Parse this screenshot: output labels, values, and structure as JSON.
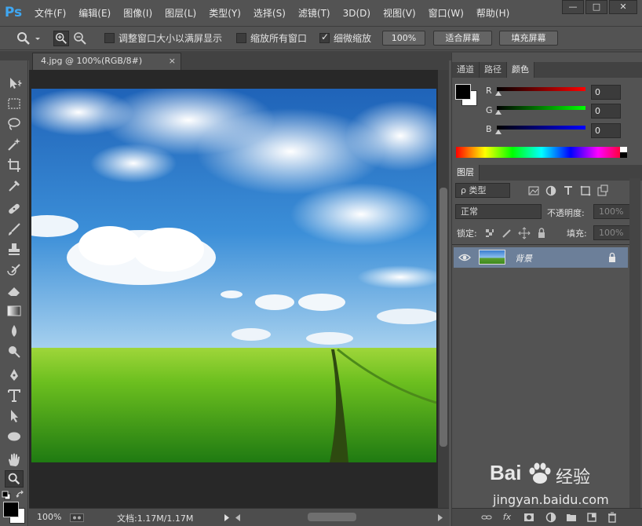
{
  "app": {
    "logo": "Ps",
    "menus": [
      "文件(F)",
      "编辑(E)",
      "图像(I)",
      "图层(L)",
      "类型(Y)",
      "选择(S)",
      "滤镜(T)",
      "3D(D)",
      "视图(V)",
      "窗口(W)",
      "帮助(H)"
    ],
    "window_controls": [
      "—",
      "□",
      "✕"
    ]
  },
  "options": {
    "resize_windows_label": "调整窗口大小以满屏显示",
    "resize_windows_checked": false,
    "zoom_all_label": "缩放所有窗口",
    "zoom_all_checked": false,
    "scrubby_label": "细微缩放",
    "scrubby_checked": true,
    "btn_100": "100%",
    "btn_fit": "适合屏幕",
    "btn_fill": "填充屏幕"
  },
  "document": {
    "tab_title": "4.jpg @ 100%(RGB/8#)",
    "tab_close": "×",
    "zoom": "100%",
    "doc_info": "文档:1.17M/1.17M"
  },
  "color_panel": {
    "tabs": [
      "通道",
      "路径",
      "颜色"
    ],
    "active_tab": "颜色",
    "channels": [
      {
        "label": "R",
        "value": "0"
      },
      {
        "label": "G",
        "value": "0"
      },
      {
        "label": "B",
        "value": "0"
      }
    ],
    "colors": {
      "fg": "#000000",
      "bg": "#ffffff"
    }
  },
  "layers_panel": {
    "tab": "图层",
    "filter_label": "ρ 类型",
    "blend_mode": "正常",
    "opacity_label": "不透明度:",
    "opacity_value": "100%",
    "lock_label": "锁定:",
    "fill_label": "填充:",
    "fill_value": "100%",
    "layers": [
      {
        "name": "背景",
        "locked": true,
        "visible": true
      }
    ],
    "bottom_icons": [
      "link-icon",
      "fx-icon",
      "mask-icon",
      "adjustment-icon",
      "group-icon",
      "new-layer-icon",
      "trash-icon"
    ]
  },
  "watermark": {
    "brand": "Bai",
    "brand2": "经验",
    "url": "jingyan.baidu.com"
  }
}
